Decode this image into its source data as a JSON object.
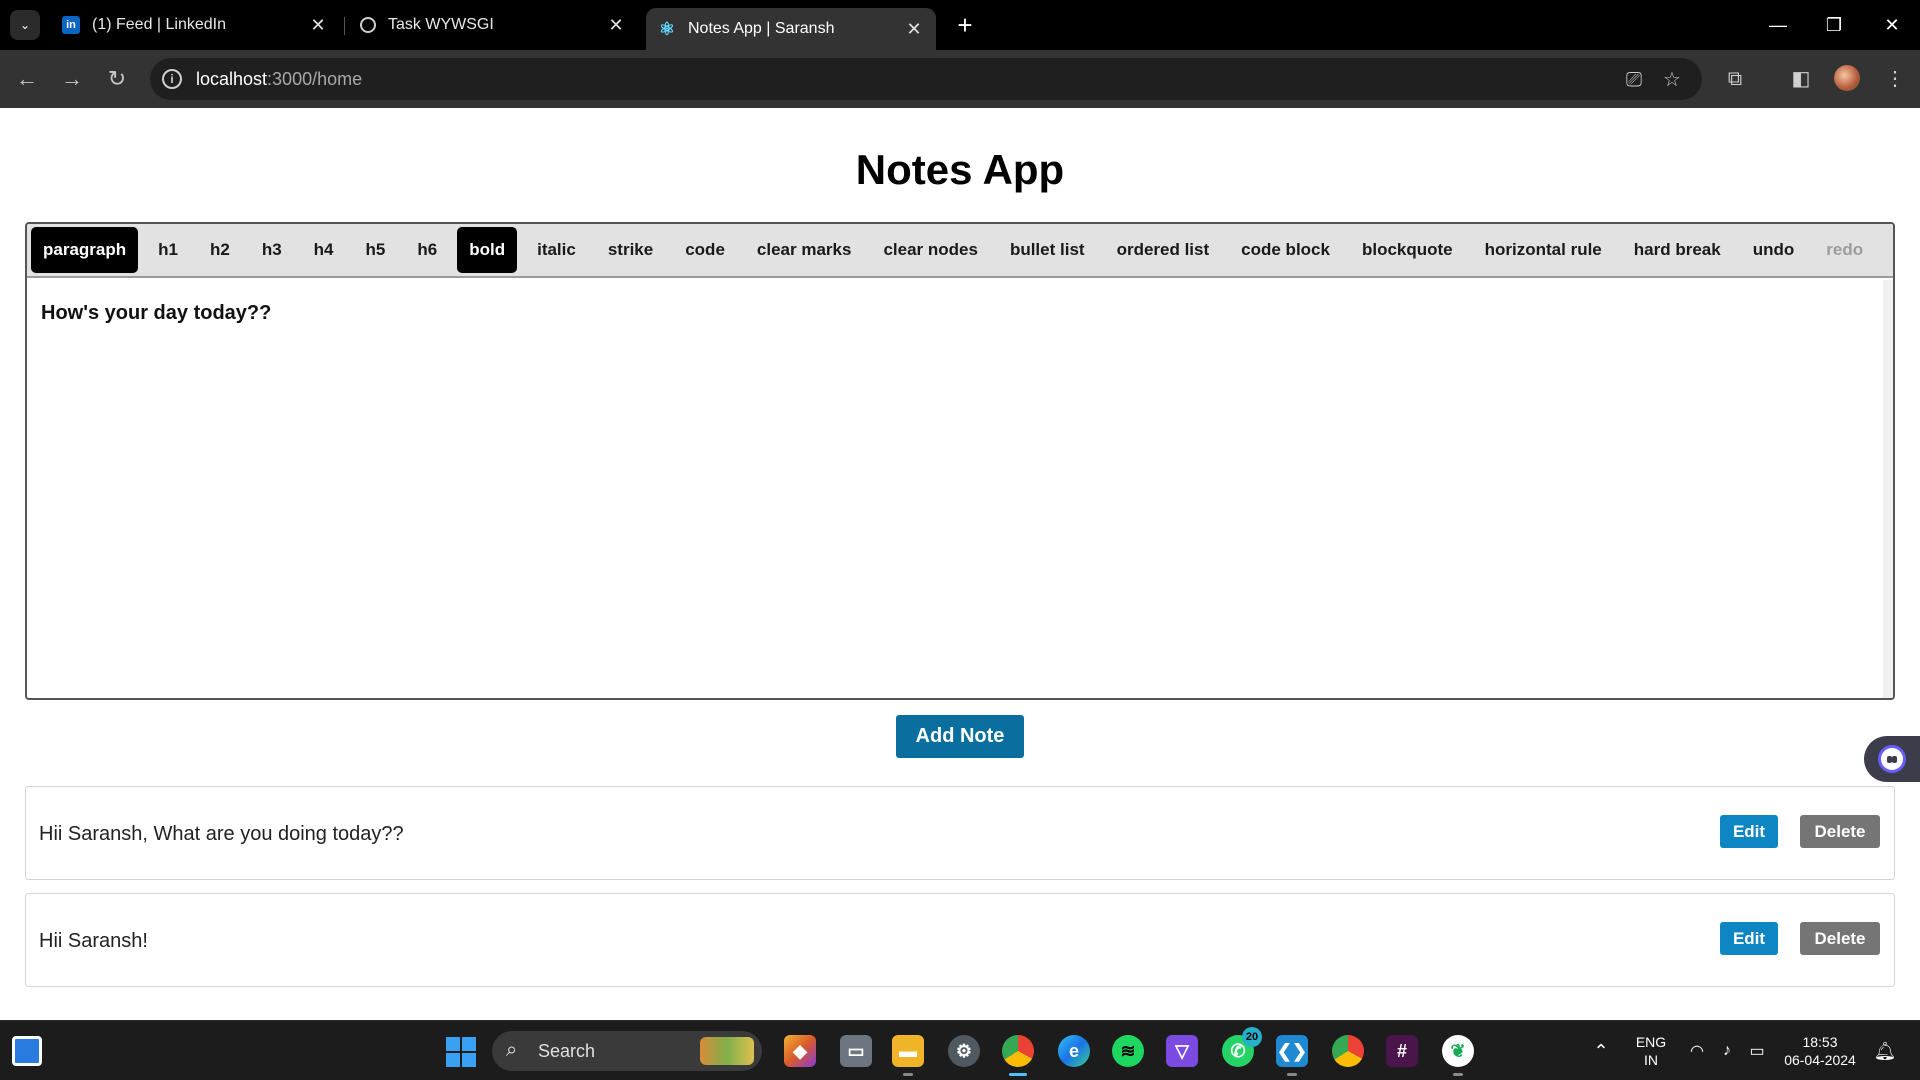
{
  "browser": {
    "tabs": [
      {
        "title": "(1) Feed | LinkedIn",
        "favicon": "linkedin-icon"
      },
      {
        "title": "Task WYWSGI",
        "favicon": "globe-icon"
      },
      {
        "title": "Notes App | Saransh",
        "favicon": "react-icon",
        "active": true
      }
    ],
    "url_host": "localhost",
    "url_rest": ":3000/home"
  },
  "app": {
    "title": "Notes App",
    "menu": [
      {
        "label": "paragraph",
        "state": "active"
      },
      {
        "label": "h1",
        "state": "normal"
      },
      {
        "label": "h2",
        "state": "normal"
      },
      {
        "label": "h3",
        "state": "normal"
      },
      {
        "label": "h4",
        "state": "normal"
      },
      {
        "label": "h5",
        "state": "normal"
      },
      {
        "label": "h6",
        "state": "normal"
      },
      {
        "label": "bold",
        "state": "active"
      },
      {
        "label": "italic",
        "state": "normal"
      },
      {
        "label": "strike",
        "state": "normal"
      },
      {
        "label": "code",
        "state": "normal"
      },
      {
        "label": "clear marks",
        "state": "normal"
      },
      {
        "label": "clear nodes",
        "state": "normal"
      },
      {
        "label": "bullet list",
        "state": "normal"
      },
      {
        "label": "ordered list",
        "state": "normal"
      },
      {
        "label": "code block",
        "state": "normal"
      },
      {
        "label": "blockquote",
        "state": "normal"
      },
      {
        "label": "horizontal rule",
        "state": "normal"
      },
      {
        "label": "hard break",
        "state": "normal"
      },
      {
        "label": "undo",
        "state": "normal"
      },
      {
        "label": "redo",
        "state": "disabled"
      }
    ],
    "editor_text": "How's your day today??",
    "add_button": "Add Note",
    "notes": [
      {
        "text": "Hii Saransh, What are you doing today??",
        "edit": "Edit",
        "delete": "Delete"
      },
      {
        "text": "Hii Saransh!",
        "edit": "Edit",
        "delete": "Delete"
      }
    ]
  },
  "taskbar": {
    "search_label": "Search",
    "whatsapp_badge": "20",
    "lang_top": "ENG",
    "lang_bottom": "IN",
    "time": "18:53",
    "date": "06-04-2024"
  },
  "colors": {
    "add_button": "#0a6f9e",
    "edit_button": "#0f86c4",
    "delete_button": "#757575",
    "menu_active": "#000000"
  }
}
